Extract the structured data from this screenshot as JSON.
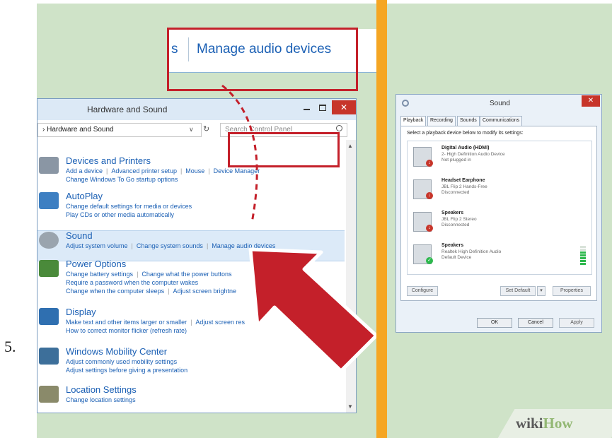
{
  "step_number": "5.",
  "zoom_banner": {
    "fragment": "s",
    "label": "Manage audio devices"
  },
  "hardware_window": {
    "title": "Hardware and Sound",
    "close_label": "✕",
    "address": "› Hardware and Sound",
    "search_placeholder": "Search Control Panel",
    "categories": [
      {
        "heading": "Devices and Printers",
        "lines": [
          [
            "Add a device",
            "Advanced printer setup",
            "Mouse",
            "Device Manager"
          ],
          [
            "Change Windows To Go startup options"
          ]
        ]
      },
      {
        "heading": "AutoPlay",
        "lines": [
          [
            "Change default settings for media or devices"
          ],
          [
            "Play CDs or other media automatically"
          ]
        ]
      },
      {
        "heading": "Sound",
        "lines": [
          [
            "Adjust system volume",
            "Change system sounds",
            "Manage audio devices"
          ]
        ]
      },
      {
        "heading": "Power Options",
        "lines": [
          [
            "Change battery settings",
            "Change what the power buttons"
          ],
          [
            "Require a password when the computer wakes"
          ],
          [
            "Change when the computer sleeps",
            "Adjust screen brightne"
          ]
        ]
      },
      {
        "heading": "Display",
        "lines": [
          [
            "Make text and other items larger or smaller",
            "Adjust screen res"
          ],
          [
            "How to correct monitor flicker (refresh rate)"
          ]
        ]
      },
      {
        "heading": "Windows Mobility Center",
        "lines": [
          [
            "Adjust commonly used mobility settings"
          ],
          [
            "Adjust settings before giving a presentation"
          ]
        ]
      },
      {
        "heading": "Location Settings",
        "lines": [
          [
            "Change location settings"
          ]
        ]
      }
    ]
  },
  "sound_dialog": {
    "title": "Sound",
    "close_label": "✕",
    "tabs": [
      "Playback",
      "Recording",
      "Sounds",
      "Communications"
    ],
    "instruction": "Select a playback device below to modify its settings:",
    "devices": [
      {
        "name": "Digital Audio (HDMI)",
        "desc1": "2- High Definition Audio Device",
        "desc2": "Not plugged in",
        "badge": "down"
      },
      {
        "name": "Headset Earphone",
        "desc1": "JBL Flip 2 Hands-Free",
        "desc2": "Disconnected",
        "badge": "down"
      },
      {
        "name": "Speakers",
        "desc1": "JBL Flip 2 Stereo",
        "desc2": "Disconnected",
        "badge": "down"
      },
      {
        "name": "Speakers",
        "desc1": "Realtek High Definition Audio",
        "desc2": "Default Device",
        "badge": "check"
      }
    ],
    "level_bars_lit": 5,
    "level_bars_total": 7,
    "buttons": {
      "configure": "Configure",
      "set_default": "Set Default",
      "set_default_arrow": "▾",
      "properties": "Properties",
      "ok": "OK",
      "cancel": "Cancel",
      "apply": "Apply"
    }
  },
  "watermark": {
    "wiki": "wiki",
    "how": "How"
  },
  "colors": {
    "highlight_red": "#c4202a",
    "divider_orange": "#f5a623",
    "panel_green": "#cfe3c8",
    "link_blue": "#1a5fb4"
  }
}
